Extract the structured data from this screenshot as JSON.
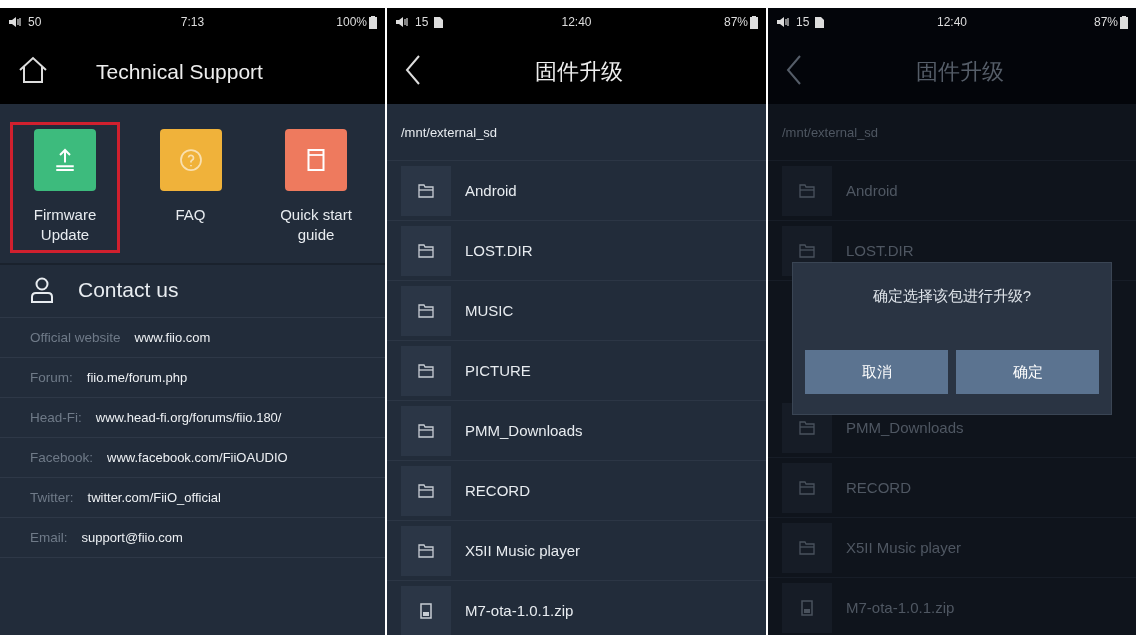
{
  "screens": [
    {
      "kind": "support",
      "status": {
        "volume": "50",
        "time": "7:13",
        "battery": "100%"
      },
      "header": {
        "title": "Technical Support"
      },
      "tiles": [
        {
          "label": "Firmware Update",
          "color": "#3dbb7d",
          "selected": true
        },
        {
          "label": "FAQ",
          "color": "#f0b23a",
          "selected": false
        },
        {
          "label": "Quick start guide",
          "color": "#ee7a5e",
          "selected": false
        }
      ],
      "contact_title": "Contact us",
      "contacts": [
        {
          "label": "Official website",
          "value": "www.fiio.com"
        },
        {
          "label": "Forum:",
          "value": "fiio.me/forum.php"
        },
        {
          "label": "Head-Fi:",
          "value": "www.head-fi.org/forums/fiio.180/"
        },
        {
          "label": "Facebook:",
          "value": "www.facebook.com/FiiOAUDIO"
        },
        {
          "label": "Twitter:",
          "value": "twitter.com/FiiO_official"
        },
        {
          "label": "Email:",
          "value": "support@fiio.com"
        }
      ]
    },
    {
      "kind": "files",
      "dimmed": false,
      "status": {
        "volume": "15",
        "sd_card": true,
        "time": "12:40",
        "battery": "87%"
      },
      "header": {
        "title": "固件升级"
      },
      "path": "/mnt/external_sd",
      "files_above_dialog": [
        {
          "name": "Android",
          "kind": "folder"
        },
        {
          "name": "LOST.DIR",
          "kind": "folder"
        },
        {
          "name": "MUSIC",
          "kind": "folder"
        },
        {
          "name": "PICTURE",
          "kind": "folder"
        },
        {
          "name": "PMM_Downloads",
          "kind": "folder"
        },
        {
          "name": "RECORD",
          "kind": "folder"
        },
        {
          "name": "X5II Music player",
          "kind": "folder"
        },
        {
          "name": "M7-ota-1.0.1.zip",
          "kind": "file"
        }
      ]
    },
    {
      "kind": "files",
      "dimmed": true,
      "status": {
        "volume": "15",
        "sd_card": true,
        "time": "12:40",
        "battery": "87%"
      },
      "header": {
        "title": "固件升级"
      },
      "path": "/mnt/external_sd",
      "files_above_dialog": [
        {
          "name": "Android",
          "kind": "folder"
        },
        {
          "name": "LOST.DIR",
          "kind": "folder"
        }
      ],
      "dialog": {
        "message": "确定选择该包进行升级?",
        "buttons": [
          "取消",
          "确定"
        ]
      },
      "files_below_dialog": [
        {
          "name": "PMM_Downloads",
          "kind": "folder"
        },
        {
          "name": "RECORD",
          "kind": "folder"
        },
        {
          "name": "X5II Music player",
          "kind": "folder"
        },
        {
          "name": "M7-ota-1.0.1.zip",
          "kind": "file"
        }
      ]
    }
  ]
}
